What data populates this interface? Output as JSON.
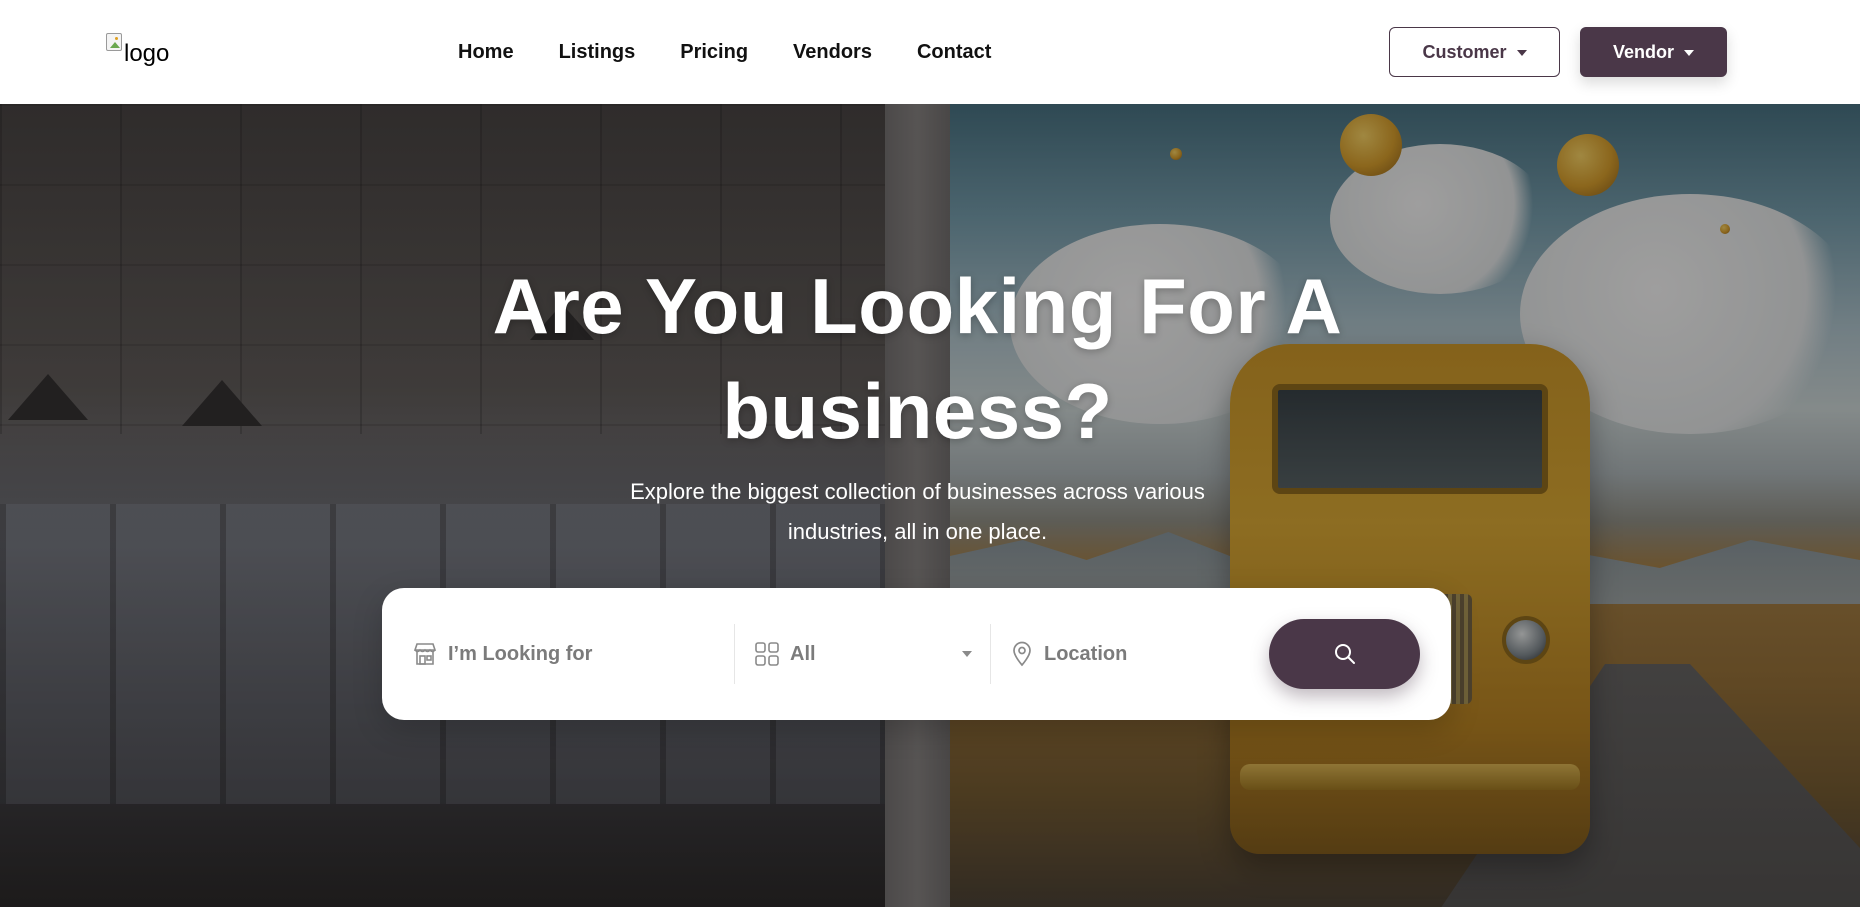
{
  "header": {
    "logo_alt": "logo",
    "nav": [
      {
        "label": "Home"
      },
      {
        "label": "Listings"
      },
      {
        "label": "Pricing"
      },
      {
        "label": "Vendors"
      },
      {
        "label": "Contact"
      }
    ],
    "customer_label": "Customer",
    "vendor_label": "Vendor"
  },
  "hero": {
    "title": "Are You Looking For A business?",
    "subtitle": "Explore the biggest collection of businesses across various industries, all in one place."
  },
  "search": {
    "keyword_placeholder": "I’m Looking for",
    "category_value": "All",
    "location_placeholder": "Location"
  },
  "icons": {
    "keyword": "storefront-icon",
    "category": "grid-icon",
    "location": "map-pin-icon",
    "search": "search-icon",
    "dropdown": "caret-down-icon"
  },
  "colors": {
    "brand": "#4a3748",
    "header_bg": "#ffffff",
    "text_on_hero": "#ffffff"
  }
}
